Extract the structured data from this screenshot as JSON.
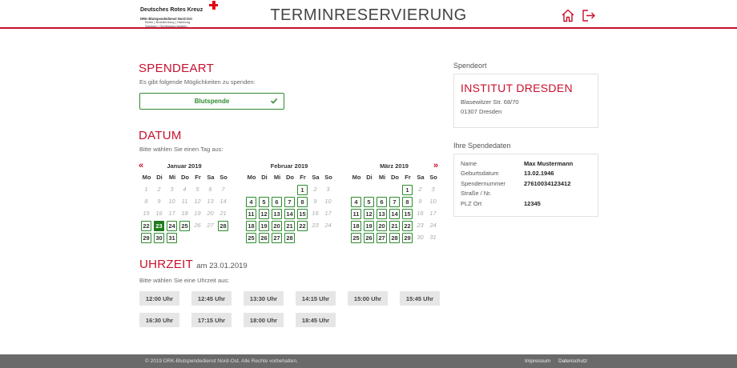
{
  "header": {
    "logo_title": "Deutsches Rotes Kreuz",
    "logo_sub": "DRK-Blutspendedienst Nord-Ost",
    "logo_regions_1": "Berlin | Brandenburg | Hamburg",
    "logo_regions_2": "Sachsen | Schleswig-Holstein",
    "title": "TERMINRESERVIERUNG",
    "home_icon": "home-icon",
    "logout_icon": "logout-icon"
  },
  "spendeart": {
    "title": "SPENDEART",
    "subtitle": "Es gibt folgende Möglichkeiten zu spenden:",
    "option": "Blutspende"
  },
  "datum": {
    "title": "DATUM",
    "subtitle": "Bitte wählen Sie einen Tag aus:",
    "prev": "«",
    "next": "»",
    "weekdays": [
      "Mo",
      "Di",
      "Mi",
      "Do",
      "Fr",
      "Sa",
      "So"
    ],
    "months": [
      {
        "name": "Januar 2019",
        "offset": 0,
        "days": 31,
        "available": [
          22,
          23,
          24,
          25,
          28,
          29,
          30,
          31
        ],
        "selected": 23
      },
      {
        "name": "Februar 2019",
        "offset": 4,
        "days": 28,
        "available": [
          1,
          4,
          5,
          6,
          7,
          8,
          11,
          12,
          13,
          14,
          15,
          18,
          19,
          20,
          21,
          22,
          25,
          26,
          27,
          28
        ],
        "selected": null
      },
      {
        "name": "März 2019",
        "offset": 4,
        "days": 31,
        "available": [
          1,
          4,
          5,
          6,
          7,
          8,
          11,
          12,
          13,
          14,
          15,
          18,
          19,
          20,
          21,
          22,
          25,
          26,
          27,
          28,
          29
        ],
        "selected": null
      }
    ]
  },
  "uhrzeit": {
    "title": "UHRZEIT",
    "date_suffix": "am 23.01.2019",
    "subtitle": "Bitte wählen Sie eine Uhrzeit aus:",
    "times": [
      "12:00 Uhr",
      "12:45 Uhr",
      "13:30 Uhr",
      "14:15 Uhr",
      "15:00 Uhr",
      "15:45 Uhr",
      "16:30 Uhr",
      "17:15 Uhr",
      "18:00 Uhr",
      "18:45 Uhr"
    ]
  },
  "spendeort": {
    "label": "Spendeort",
    "name": "INSTITUT DRESDEN",
    "street": "Blasewitzer Str. 68/70",
    "city": "01307 Dresden"
  },
  "spendedaten": {
    "label": "Ihre Spendedaten",
    "rows": [
      {
        "key": "Name",
        "value": "Max Mustermann"
      },
      {
        "key": "Geburtsdatum",
        "value": "13.02.1946"
      },
      {
        "key": "Spendernummer",
        "value": "27610034123412"
      },
      {
        "key": "Straße / Nr.",
        "value": ""
      },
      {
        "key": "PLZ Ort",
        "value": "12345"
      }
    ]
  },
  "footer": {
    "copyright": "© 2019 DRK-Blutspendedienst Nord-Ost. Alle Rechte vorbehalten.",
    "impressum": "Impressum",
    "datenschutz": "Datenschutz"
  },
  "colors": {
    "brand_red": "#c8102e",
    "available_green": "#2e8b2e",
    "selected_green": "#1e7a1e"
  }
}
